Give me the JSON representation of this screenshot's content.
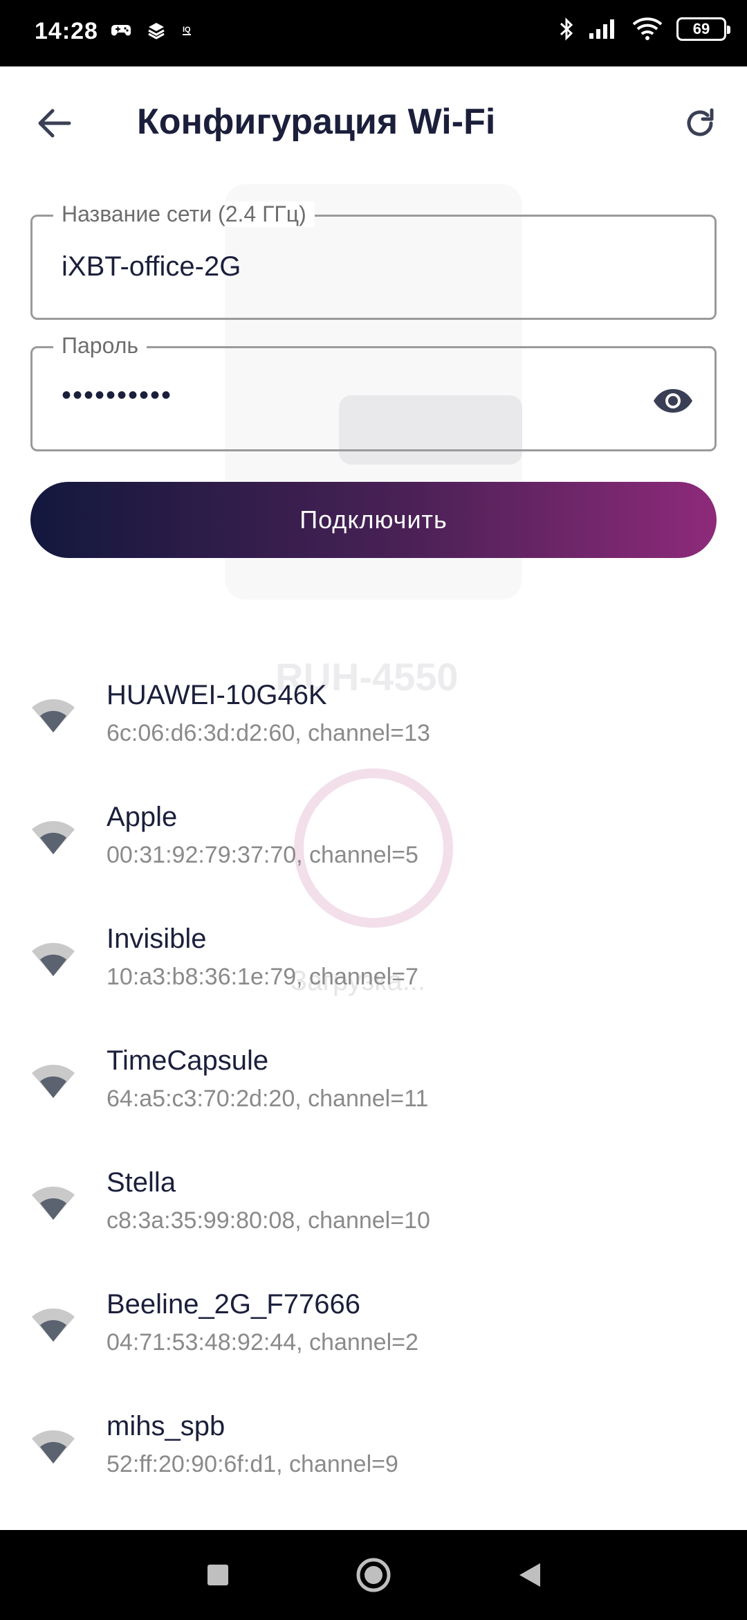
{
  "status_bar": {
    "time": "14:28",
    "battery": "69",
    "left_icons": [
      "gamepad-icon",
      "layers-icon",
      "iq-icon"
    ],
    "right_icons": [
      "bluetooth-icon",
      "signal-icon",
      "wifi-icon",
      "battery-icon"
    ]
  },
  "appbar": {
    "title": "Конфигурация Wi-Fi",
    "back_icon": "arrow-left-icon",
    "refresh_icon": "refresh-icon"
  },
  "form": {
    "ssid_label": "Название сети (2.4 ГГц)",
    "ssid_value": "iXBT-office-2G",
    "password_label": "Пароль",
    "password_value": "••••••••••",
    "visibility_icon": "eye-icon",
    "connect_label": "Подключить"
  },
  "watermark": {
    "model": "RUH-4550",
    "loading": "Загрузка..."
  },
  "networks": [
    {
      "name": "HUAWEI-10G46K",
      "info": "6c:06:d6:3d:d2:60, channel=13"
    },
    {
      "name": "Apple",
      "info": "00:31:92:79:37:70, channel=5"
    },
    {
      "name": "Invisible",
      "info": "10:a3:b8:36:1e:79, channel=7"
    },
    {
      "name": "TimeCapsule",
      "info": "64:a5:c3:70:2d:20, channel=11"
    },
    {
      "name": "Stella",
      "info": "c8:3a:35:99:80:08, channel=10"
    },
    {
      "name": "Beeline_2G_F77666",
      "info": "04:71:53:48:92:44, channel=2"
    },
    {
      "name": "mihs_spb",
      "info": "52:ff:20:90:6f:d1, channel=9"
    }
  ],
  "colors": {
    "accent_dark": "#13183d",
    "accent_purple": "#8e2a7a",
    "text_primary": "#1b1f3b",
    "text_secondary": "#8a8a8a"
  },
  "nav_bar": {
    "icons": [
      "recents-square-icon",
      "home-circle-icon",
      "back-triangle-icon"
    ]
  }
}
